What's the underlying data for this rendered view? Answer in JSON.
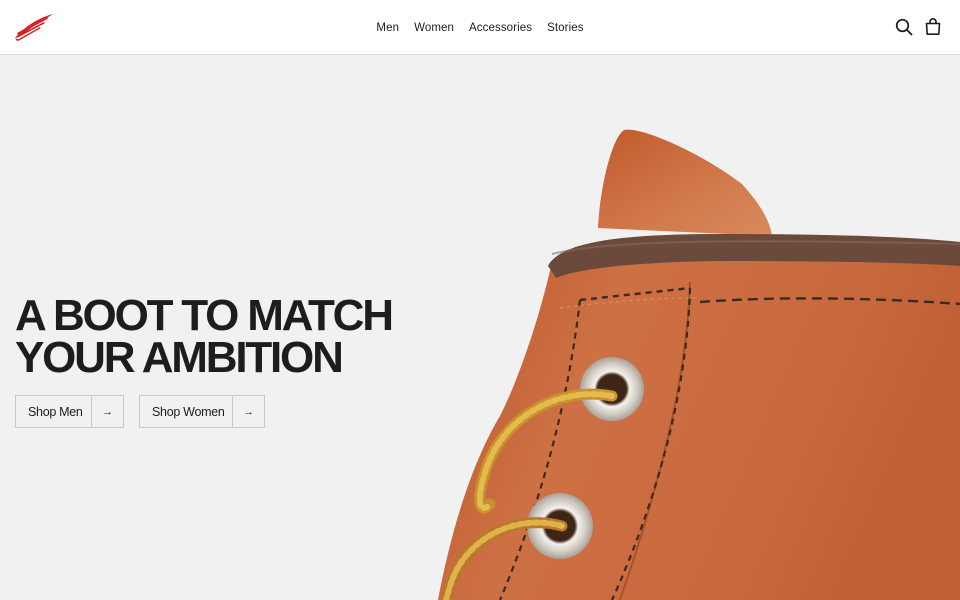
{
  "brand": {
    "logo_icon": "wing-logo-icon",
    "accent": "#d81f26"
  },
  "nav": {
    "items": [
      {
        "label": "Men"
      },
      {
        "label": "Women"
      },
      {
        "label": "Accessories"
      },
      {
        "label": "Stories"
      }
    ]
  },
  "header_icons": {
    "search": "search-icon",
    "cart": "bag-icon"
  },
  "hero": {
    "headline_line1": "A BOOT TO MATCH",
    "headline_line2": "YOUR AMBITION",
    "image": "boot-closeup",
    "buttons": [
      {
        "label": "Shop Men",
        "arrow": "→"
      },
      {
        "label": "Shop Women",
        "arrow": "→"
      }
    ]
  },
  "colors": {
    "leather": "#c8683a",
    "collar": "#6b4a3c",
    "background": "#f1f1f1",
    "text": "#1d1d1f"
  }
}
